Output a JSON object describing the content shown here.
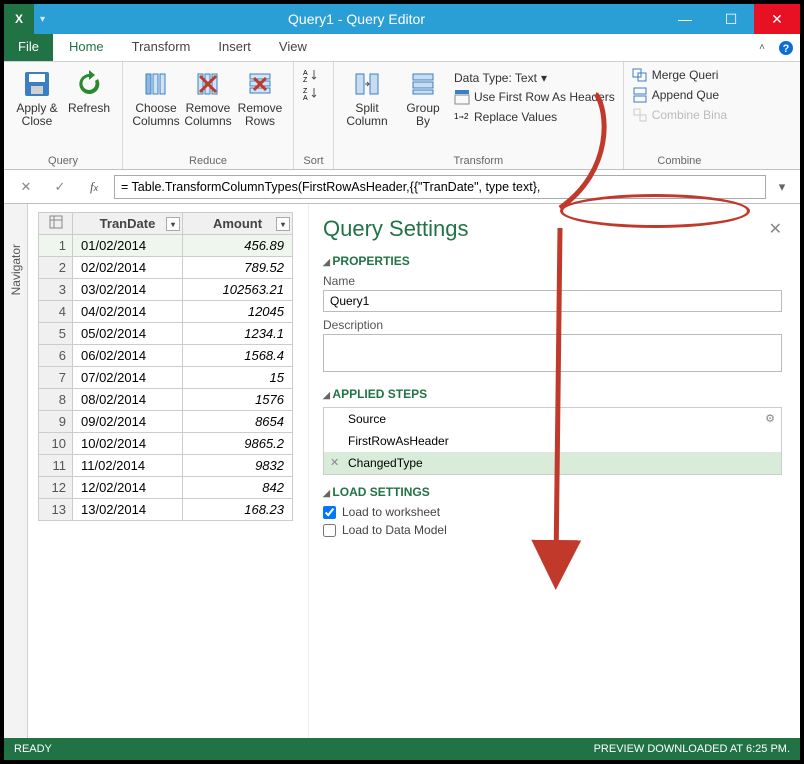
{
  "window": {
    "title": "Query1 - Query Editor",
    "app_icon_text": "X"
  },
  "tabs": {
    "file": "File",
    "home": "Home",
    "transform": "Transform",
    "insert": "Insert",
    "view": "View"
  },
  "ribbon": {
    "query": {
      "label": "Query",
      "apply_close": "Apply &\nClose",
      "refresh": "Refresh"
    },
    "reduce": {
      "label": "Reduce",
      "choose_cols": "Choose\nColumns",
      "remove_cols": "Remove\nColumns",
      "remove_rows": "Remove\nRows"
    },
    "sort": {
      "label": "Sort"
    },
    "transform": {
      "label": "Transform",
      "split_col": "Split\nColumn",
      "group_by": "Group\nBy",
      "data_type": "Data Type: Text",
      "first_row": "Use First Row As Headers",
      "replace": "Replace Values"
    },
    "combine": {
      "label": "Combine",
      "merge": "Merge Queri",
      "append": "Append Que",
      "combine_bin": "Combine Bina"
    }
  },
  "formula": "= Table.TransformColumnTypes(FirstRowAsHeader,{{\"TranDate\", type text},",
  "grid": {
    "col1": "TranDate",
    "col2": "Amount",
    "rows": [
      {
        "n": "1",
        "d": "01/02/2014",
        "a": "456.89"
      },
      {
        "n": "2",
        "d": "02/02/2014",
        "a": "789.52"
      },
      {
        "n": "3",
        "d": "03/02/2014",
        "a": "102563.21"
      },
      {
        "n": "4",
        "d": "04/02/2014",
        "a": "12045"
      },
      {
        "n": "5",
        "d": "05/02/2014",
        "a": "1234.1"
      },
      {
        "n": "6",
        "d": "06/02/2014",
        "a": "1568.4"
      },
      {
        "n": "7",
        "d": "07/02/2014",
        "a": "15"
      },
      {
        "n": "8",
        "d": "08/02/2014",
        "a": "1576"
      },
      {
        "n": "9",
        "d": "09/02/2014",
        "a": "8654"
      },
      {
        "n": "10",
        "d": "10/02/2014",
        "a": "9865.2"
      },
      {
        "n": "11",
        "d": "11/02/2014",
        "a": "9832"
      },
      {
        "n": "12",
        "d": "12/02/2014",
        "a": "842"
      },
      {
        "n": "13",
        "d": "13/02/2014",
        "a": "168.23"
      }
    ]
  },
  "settings": {
    "title": "Query Settings",
    "properties": "PROPERTIES",
    "name_label": "Name",
    "name_value": "Query1",
    "desc_label": "Description",
    "applied_steps": "APPLIED STEPS",
    "steps": {
      "source": "Source",
      "first_row": "FirstRowAsHeader",
      "changed": "ChangedType"
    },
    "load_settings": "LOAD SETTINGS",
    "load_ws": "Load to worksheet",
    "load_dm": "Load to Data Model"
  },
  "status": {
    "ready": "READY",
    "preview": "PREVIEW DOWNLOADED AT 6:25 PM."
  },
  "chart_data": {
    "type": "table",
    "columns": [
      "TranDate",
      "Amount"
    ],
    "rows": [
      [
        "01/02/2014",
        456.89
      ],
      [
        "02/02/2014",
        789.52
      ],
      [
        "03/02/2014",
        102563.21
      ],
      [
        "04/02/2014",
        12045
      ],
      [
        "05/02/2014",
        1234.1
      ],
      [
        "06/02/2014",
        1568.4
      ],
      [
        "07/02/2014",
        15
      ],
      [
        "08/02/2014",
        1576
      ],
      [
        "09/02/2014",
        8654
      ],
      [
        "10/02/2014",
        9865.2
      ],
      [
        "11/02/2014",
        9832
      ],
      [
        "12/02/2014",
        842
      ],
      [
        "13/02/2014",
        168.23
      ]
    ]
  }
}
